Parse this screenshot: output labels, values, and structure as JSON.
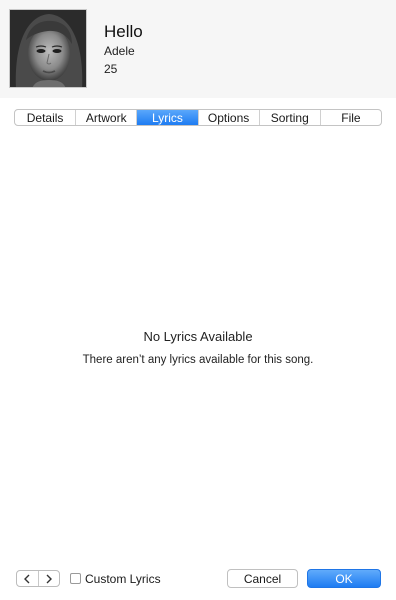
{
  "header": {
    "artwork_icon": "album-artwork-portrait",
    "title": "Hello",
    "artist": "Adele",
    "album": "25"
  },
  "tabs": [
    {
      "label": "Details",
      "selected": false
    },
    {
      "label": "Artwork",
      "selected": false
    },
    {
      "label": "Lyrics",
      "selected": true
    },
    {
      "label": "Options",
      "selected": false
    },
    {
      "label": "Sorting",
      "selected": false
    },
    {
      "label": "File",
      "selected": false
    }
  ],
  "lyrics": {
    "empty_title": "No Lyrics Available",
    "empty_message": "There aren’t any lyrics available for this song."
  },
  "footer": {
    "prev_icon": "chevron-left-icon",
    "next_icon": "chevron-right-icon",
    "custom_lyrics_label": "Custom Lyrics",
    "custom_lyrics_checked": false,
    "cancel_label": "Cancel",
    "ok_label": "OK"
  },
  "colors": {
    "accent": "#1e7cf2",
    "header_bg": "#f6f6f6"
  }
}
